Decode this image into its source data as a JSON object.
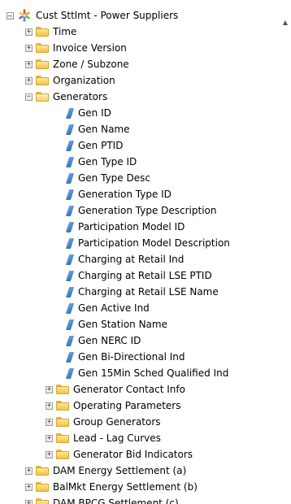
{
  "tree": {
    "root": {
      "label": "Cust Sttlmt - Power Suppliers",
      "expander": "⊟"
    },
    "top_folders": [
      {
        "label": "Time",
        "expander": "+"
      },
      {
        "label": "Invoice Version",
        "expander": "+"
      },
      {
        "label": "Zone / Subzone",
        "expander": "+"
      },
      {
        "label": "Organization",
        "expander": "+"
      }
    ],
    "generators": {
      "label": "Generators",
      "expander": "−",
      "attributes": [
        "Gen ID",
        "Gen Name",
        "Gen PTID",
        "Gen Type ID",
        "Gen Type Desc",
        "Generation Type ID",
        "Generation Type Description",
        "Participation Model ID",
        "Participation Model Description",
        "Charging at Retail Ind",
        "Charging at Retail LSE PTID",
        "Charging at Retail LSE Name",
        "Gen Active Ind",
        "Gen Station Name",
        "Gen NERC ID",
        "Gen Bi-Directional Ind",
        "Gen 15Min Sched Qualified Ind"
      ],
      "subfolders": [
        {
          "label": "Generator Contact Info",
          "expander": "+"
        },
        {
          "label": "Operating Parameters",
          "expander": "+"
        },
        {
          "label": "Group Generators",
          "expander": "+"
        },
        {
          "label": "Lead - Lag Curves",
          "expander": "+"
        },
        {
          "label": "Generator Bid Indicators",
          "expander": "+"
        }
      ]
    },
    "bottom_folders": [
      {
        "label": "DAM Energy Settlement (a)",
        "expander": "+"
      },
      {
        "label": "BalMkt Energy Settlement (b)",
        "expander": "+"
      },
      {
        "label": "DAM BPCG Settlement (c)",
        "expander": "+"
      }
    ]
  },
  "icons": {
    "root": "sparkle-cube-icon",
    "folder": "folder-icon",
    "folder_open": "folder-open-icon",
    "attribute": "attribute-leaf-icon",
    "scroll_up": "scroll-up-arrow-icon"
  },
  "scrollbar": {
    "up_arrow": "▲"
  }
}
